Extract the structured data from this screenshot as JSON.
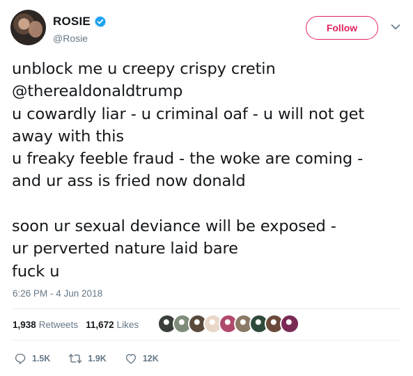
{
  "author": {
    "display_name": "ROSIE",
    "handle": "@Rosie",
    "verified_icon": "verified-badge-icon",
    "avatar_icon": "profile-avatar"
  },
  "follow": {
    "label": "Follow",
    "color": "#e0245e"
  },
  "tweet": {
    "lines": [
      "unblock me u creepy crispy cretin",
      "@therealdonaldtrump",
      "u cowardly liar - u criminal oaf - u will not get",
      "away with this",
      "u freaky feeble fraud - the woke are coming -",
      "and ur ass is fried now donald",
      "",
      "soon ur sexual deviance will be exposed -",
      "ur perverted nature laid bare",
      "fuck u"
    ],
    "timestamp": "6:26 PM - 4 Jun 2018"
  },
  "stats": {
    "retweets_count": "1,938",
    "retweets_label": "Retweets",
    "likes_count": "11,672",
    "likes_label": "Likes",
    "face_colors": [
      "#3a3f3a",
      "#7f8c7a",
      "#5a4a3c",
      "#e9d8c8",
      "#b04a6a",
      "#8a7a66",
      "#2f4a3a",
      "#6b4a3a",
      "#7a2a55"
    ]
  },
  "actions": {
    "reply_count": "1.5K",
    "retweet_count": "1.9K",
    "like_count": "12K"
  },
  "colors": {
    "text": "#14171a",
    "secondary": "#657786",
    "verified": "#1da1f2",
    "divider": "#e6ecf0"
  }
}
